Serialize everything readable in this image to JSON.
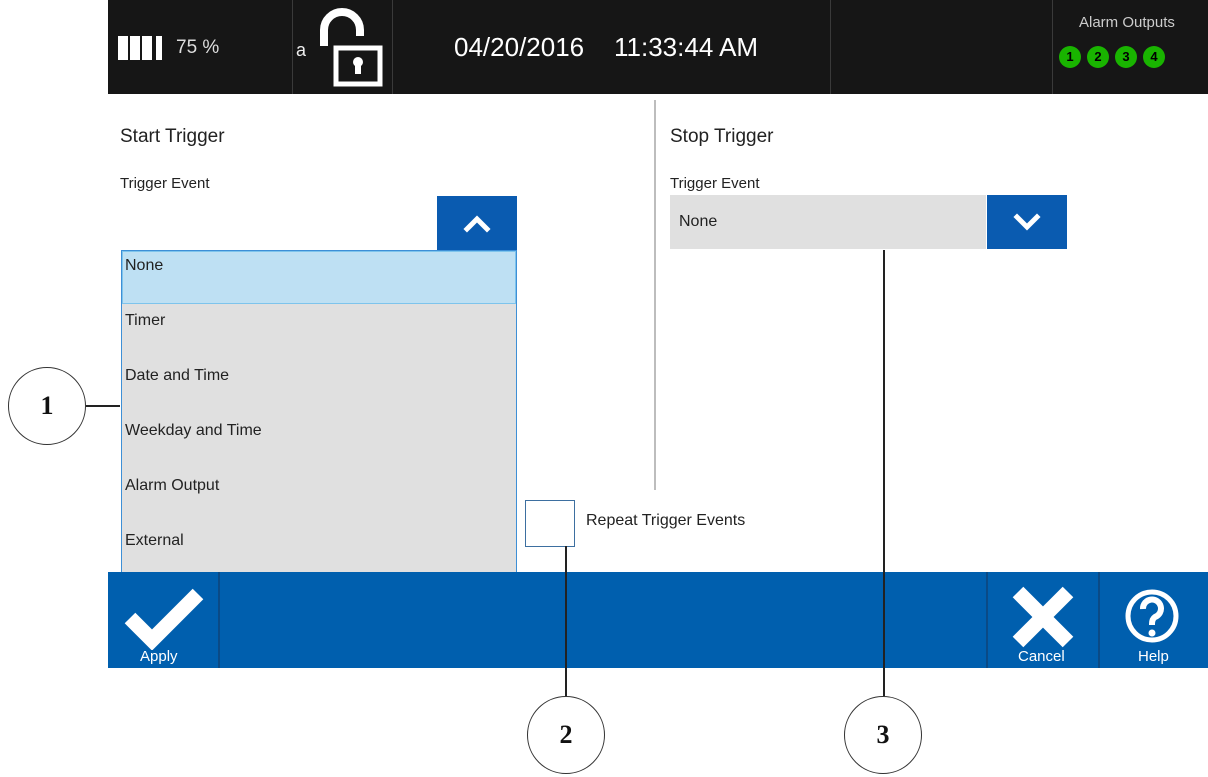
{
  "status_bar": {
    "battery_percent": "75 %",
    "lock_user_letter": "a",
    "date": "04/20/2016",
    "time": "11:33:44 AM",
    "alarm_outputs_title": "Alarm Outputs",
    "alarm_outputs": [
      "1",
      "2",
      "3",
      "4"
    ],
    "alarm_color": "#19b400"
  },
  "start_trigger": {
    "heading": "Start Trigger",
    "event_label": "Trigger Event",
    "options": [
      "None",
      "Timer",
      "Date and Time",
      "Weekday and Time",
      "Alarm Output",
      "External"
    ],
    "selected": "None"
  },
  "stop_trigger": {
    "heading": "Stop Trigger",
    "event_label": "Trigger Event",
    "selected_value": "None"
  },
  "repeat_trigger_label": "Repeat Trigger Events",
  "bottom_bar": {
    "apply_label": "Apply",
    "cancel_label": "Cancel",
    "help_label": "Help"
  },
  "callouts": [
    "1",
    "2",
    "3"
  ],
  "accent_color": "#005fae"
}
